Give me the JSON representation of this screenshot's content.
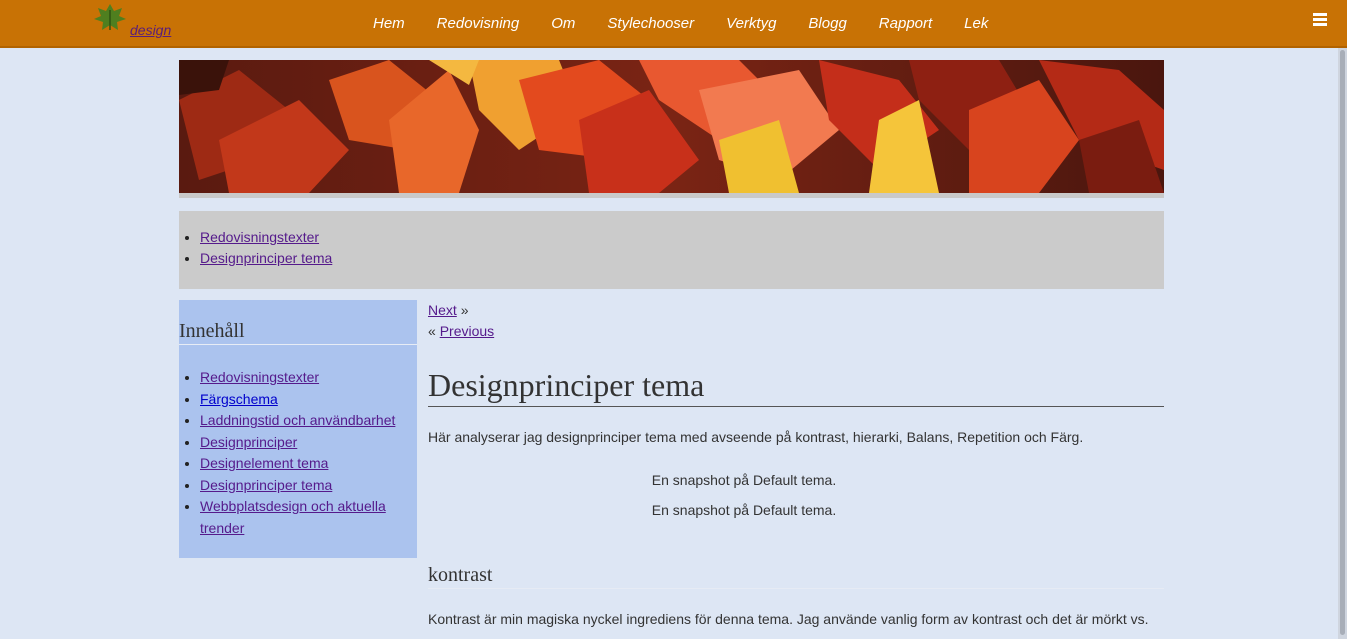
{
  "logo": {
    "text": "design",
    "icon": "leaf-icon"
  },
  "nav": [
    "Hem",
    "Redovisning",
    "Om",
    "Stylechooser",
    "Verktyg",
    "Blogg",
    "Rapport",
    "Lek"
  ],
  "menu_icon": "hamburger-icon",
  "breadcrumb": [
    "Redovisningstexter",
    "Designprinciper tema"
  ],
  "sidebar": {
    "heading": "Innehåll",
    "items": [
      "Redovisningstexter",
      "Färgschema",
      "Laddningstid och användbarhet",
      "Designprinciper",
      "Designelement tema",
      "Designprinciper tema",
      "Webbplatsdesign och aktuella trender"
    ]
  },
  "pager": {
    "next": "Next",
    "next_arrow": "»",
    "prev_arrow": "«",
    "previous": "Previous"
  },
  "article": {
    "title": "Designprinciper tema",
    "intro": "Här analyserar jag designprinciper tema med avseende på kontrast, hierarki, Balans, Repetition och Färg.",
    "snapshot_1": "En snapshot på Default tema.",
    "snapshot_2": "En snapshot på Default tema.",
    "section_heading": "kontrast",
    "section_text": "Kontrast är min magiska nyckel ingrediens för denna tema. Jag använde vanlig form av kontrast och det är mörkt vs."
  },
  "colors": {
    "navbar": "#c87205",
    "page_bg": "#dde6f4",
    "sidebar_bg": "#abc3ee",
    "breadcrumb_bg": "#cbcbcb",
    "link": "#551a8b"
  }
}
